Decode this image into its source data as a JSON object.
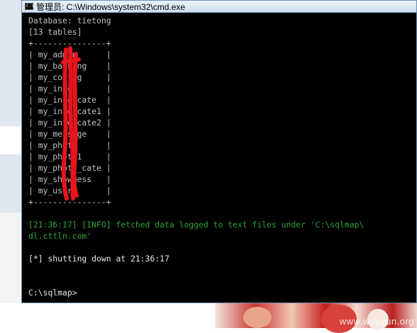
{
  "window": {
    "title": "管理员: C:\\Windows\\system32\\cmd.exe",
    "icon": "cmd-icon"
  },
  "console": {
    "database_line": "Database: tietong",
    "tables_count_line": "[13 tables]",
    "table_border": "+---------------+",
    "tables": [
      "| my_admin      |",
      "| my_banking    |",
      "| my_config     |",
      "| my_info       |",
      "| my_info_cate  |",
      "| my_info_cate1 |",
      "| my_info_cate2 |",
      "| my_message    |",
      "| my_photo      |",
      "| my_photo1     |",
      "| my_photo_cate |",
      "| my_showmess   |",
      "| my_user       |"
    ],
    "info_line_1": "[21:36:17] [INFO] fetched data logged to text files under 'C:\\sqlmap\\",
    "info_line_2": "dl.cttln.com'",
    "shutdown_line": "[*] shutting down at 21:36:17",
    "prompt": "C:\\sqlmap>"
  },
  "watermark": "www.wooyun.org",
  "colors": {
    "console_bg": "#000000",
    "console_text": "#c0c0c0",
    "info_text": "#2fa33a",
    "redaction": "#e8141c"
  }
}
